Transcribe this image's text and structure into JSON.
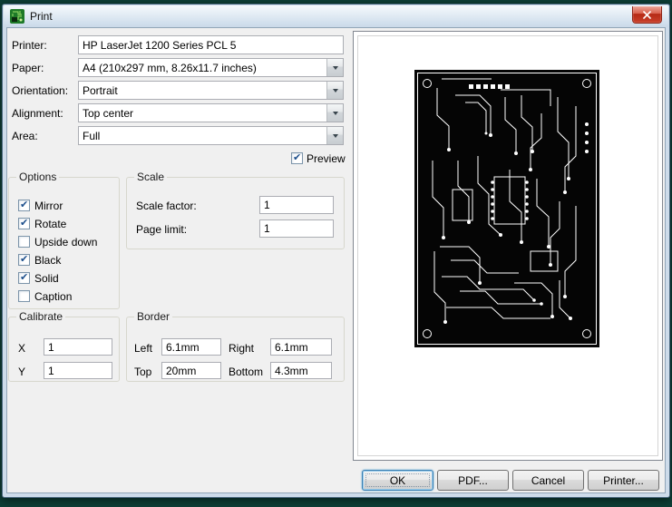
{
  "window": {
    "title": "Print"
  },
  "fields": {
    "printer": {
      "label": "Printer:",
      "value": "HP LaserJet 1200 Series PCL 5"
    },
    "paper": {
      "label": "Paper:",
      "value": "A4 (210x297 mm, 8.26x11.7 inches)"
    },
    "orientation": {
      "label": "Orientation:",
      "value": "Portrait"
    },
    "alignment": {
      "label": "Alignment:",
      "value": "Top center"
    },
    "area": {
      "label": "Area:",
      "value": "Full"
    }
  },
  "preview_toggle": {
    "label": "Preview",
    "checked": true
  },
  "options": {
    "title": "Options",
    "items": [
      {
        "label": "Mirror",
        "checked": true
      },
      {
        "label": "Rotate",
        "checked": true
      },
      {
        "label": "Upside down",
        "checked": false
      },
      {
        "label": "Black",
        "checked": true
      },
      {
        "label": "Solid",
        "checked": true
      },
      {
        "label": "Caption",
        "checked": false
      }
    ]
  },
  "scale": {
    "title": "Scale",
    "scale_factor": {
      "label": "Scale factor:",
      "value": "1"
    },
    "page_limit": {
      "label": "Page limit:",
      "value": "1"
    }
  },
  "calibrate": {
    "title": "Calibrate",
    "x": {
      "label": "X",
      "value": "1"
    },
    "y": {
      "label": "Y",
      "value": "1"
    }
  },
  "border": {
    "title": "Border",
    "left": {
      "label": "Left",
      "value": "6.1mm"
    },
    "right": {
      "label": "Right",
      "value": "6.1mm"
    },
    "top": {
      "label": "Top",
      "value": "20mm"
    },
    "bottom": {
      "label": "Bottom",
      "value": "4.3mm"
    }
  },
  "buttons": {
    "ok": "OK",
    "pdf": "PDF...",
    "cancel": "Cancel",
    "printer": "Printer..."
  },
  "colors": {
    "desktop": "#0d3e36",
    "close_button": "#c9402a",
    "default_button_border": "#3c7fb1",
    "dialog_background": "#f0f0f0"
  }
}
